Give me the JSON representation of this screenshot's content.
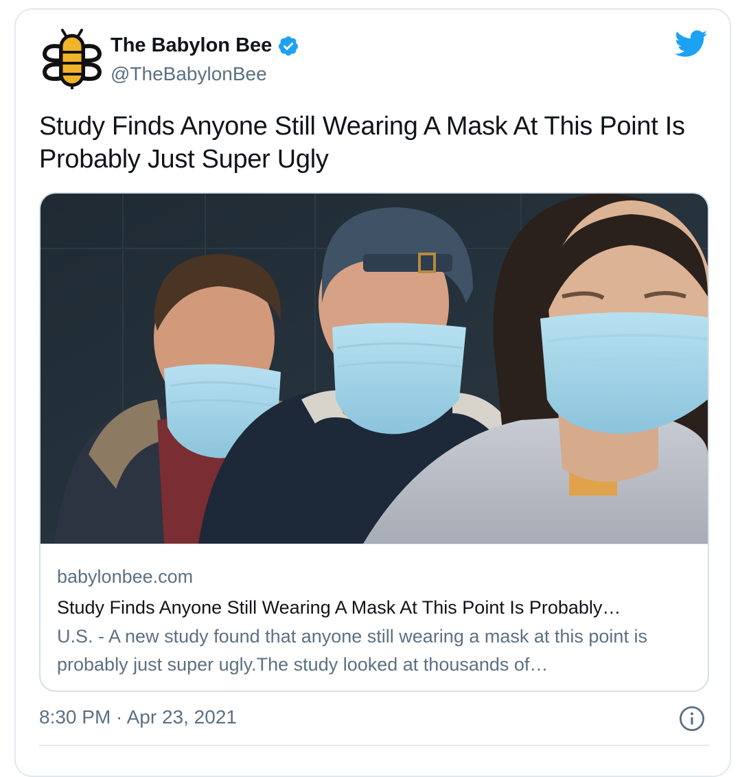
{
  "account": {
    "name": "The Babylon Bee",
    "handle": "@TheBabylonBee",
    "verified_icon": "verified-badge-icon"
  },
  "tweet": {
    "text": "Study Finds Anyone Still Wearing A Mask At This Point Is Probably Just Super Ugly",
    "timestamp": "8:30 PM · Apr 23, 2021"
  },
  "card": {
    "domain": "babylonbee.com",
    "title": "Study Finds Anyone Still Wearing A Mask At This Point Is Probably…",
    "description": "U.S. - A new study found that anyone still wearing a mask at this point is probably just super ugly.The study looked at thousands of…"
  },
  "colors": {
    "twitter_blue": "#1da1f2",
    "secondary_text": "#5b7083",
    "border": "#e1e8ed"
  },
  "icons": [
    "bee-logo-icon",
    "verified-badge-icon",
    "twitter-bird-icon",
    "info-icon"
  ]
}
